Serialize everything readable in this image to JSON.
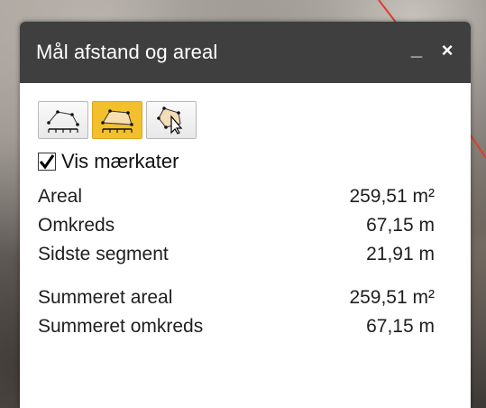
{
  "window": {
    "title": "Mål afstand og areal",
    "minimize_label": "_",
    "close_label": "×"
  },
  "tools": [
    {
      "name": "distance-tool",
      "icon": "measure-line-icon",
      "active": false
    },
    {
      "name": "area-tool",
      "icon": "measure-area-icon",
      "active": true
    },
    {
      "name": "select-tool",
      "icon": "select-area-cursor-icon",
      "active": false
    }
  ],
  "labels_toggle": {
    "label": "Vis mærkater",
    "checked": true
  },
  "measurements": [
    {
      "label": "Areal",
      "value": "259,51 m²"
    },
    {
      "label": "Omkreds",
      "value": "67,15 m"
    },
    {
      "label": "Sidste segment",
      "value": "21,91 m"
    }
  ],
  "totals": [
    {
      "label": "Summeret areal",
      "value": "259,51 m²"
    },
    {
      "label": "Summeret omkreds",
      "value": "67,15 m"
    }
  ],
  "colors": {
    "titlebar": "#3f3f3f",
    "active_tool": "#f2c02c",
    "map_line": "#e23b2e"
  }
}
